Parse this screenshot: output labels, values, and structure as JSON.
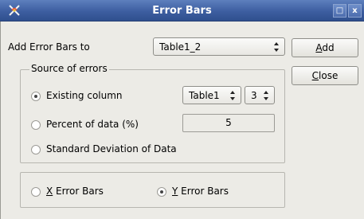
{
  "window": {
    "title": "Error Bars",
    "maximize_glyph": "□",
    "close_glyph": "x"
  },
  "add_to": {
    "label": "Add Error Bars to",
    "selected": "Table1_2"
  },
  "buttons": {
    "add": {
      "mnemonic": "A",
      "rest": "dd"
    },
    "close": {
      "mnemonic": "C",
      "rest": "lose"
    }
  },
  "source": {
    "title": "Source of errors",
    "existing_column": {
      "label": "Existing column",
      "checked": true,
      "table": "Table1",
      "column": "3"
    },
    "percent": {
      "label": "Percent of data (%)",
      "checked": false,
      "value": "5"
    },
    "std_dev": {
      "label": "Standard Deviation of Data",
      "checked": false
    }
  },
  "direction": {
    "x": {
      "mnemonic": "X",
      "rest": " Error Bars",
      "checked": false
    },
    "y": {
      "mnemonic": "Y",
      "rest": " Error Bars",
      "checked": true
    }
  },
  "icons": {
    "app": "app-icon",
    "combo": "updown-arrows-icon"
  }
}
